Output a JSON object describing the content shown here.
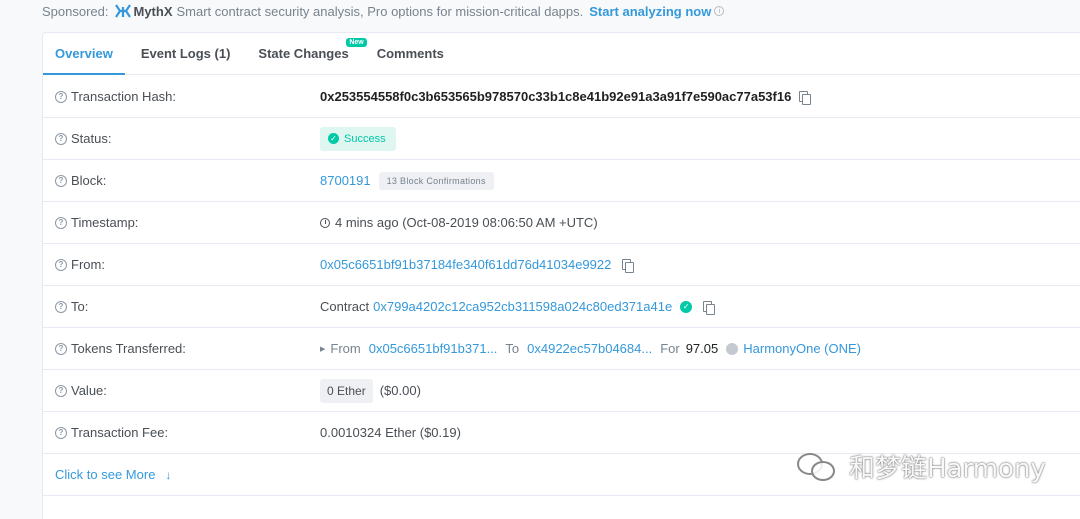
{
  "sponsor": {
    "prefix": "Sponsored:",
    "brand": "MythX",
    "text": "Smart contract security analysis, Pro options for mission-critical dapps.",
    "cta": "Start analyzing now"
  },
  "tabs": [
    {
      "label": "Overview",
      "active": true
    },
    {
      "label": "Event Logs (1)"
    },
    {
      "label": "State Changes",
      "badge": "New"
    },
    {
      "label": "Comments"
    }
  ],
  "rows": {
    "tx_hash": {
      "label": "Transaction Hash:",
      "value": "0x253554558f0c3b653565b978570c33b1c8e41b92e91a3a91f7e590ac77a53f16"
    },
    "status": {
      "label": "Status:",
      "value": "Success"
    },
    "block": {
      "label": "Block:",
      "value": "8700191",
      "confirmations": "13 Block Confirmations"
    },
    "timestamp": {
      "label": "Timestamp:",
      "value": "4 mins ago (Oct-08-2019 08:06:50 AM +UTC)"
    },
    "from": {
      "label": "From:",
      "value": "0x05c6651bf91b37184fe340f61dd76d41034e9922"
    },
    "to": {
      "label": "To:",
      "prefix": "Contract",
      "value": "0x799a4202c12ca952cb311598a024c80ed371a41e"
    },
    "tokens": {
      "label": "Tokens Transferred:",
      "from_label": "From",
      "from_value": "0x05c6651bf91b371...",
      "to_label": "To",
      "to_value": "0x4922ec57b04684...",
      "for_label": "For",
      "amount": "97.05",
      "token": "HarmonyOne (ONE)"
    },
    "value": {
      "label": "Value:",
      "ether": "0 Ether",
      "usd": "($0.00)"
    },
    "fee": {
      "label": "Transaction Fee:",
      "value": "0.0010324 Ether ($0.19)"
    }
  },
  "more_link": "Click to see More",
  "watermark": "和梦链Harmony",
  "colors": {
    "link": "#3498db",
    "success": "#00c9a7"
  }
}
